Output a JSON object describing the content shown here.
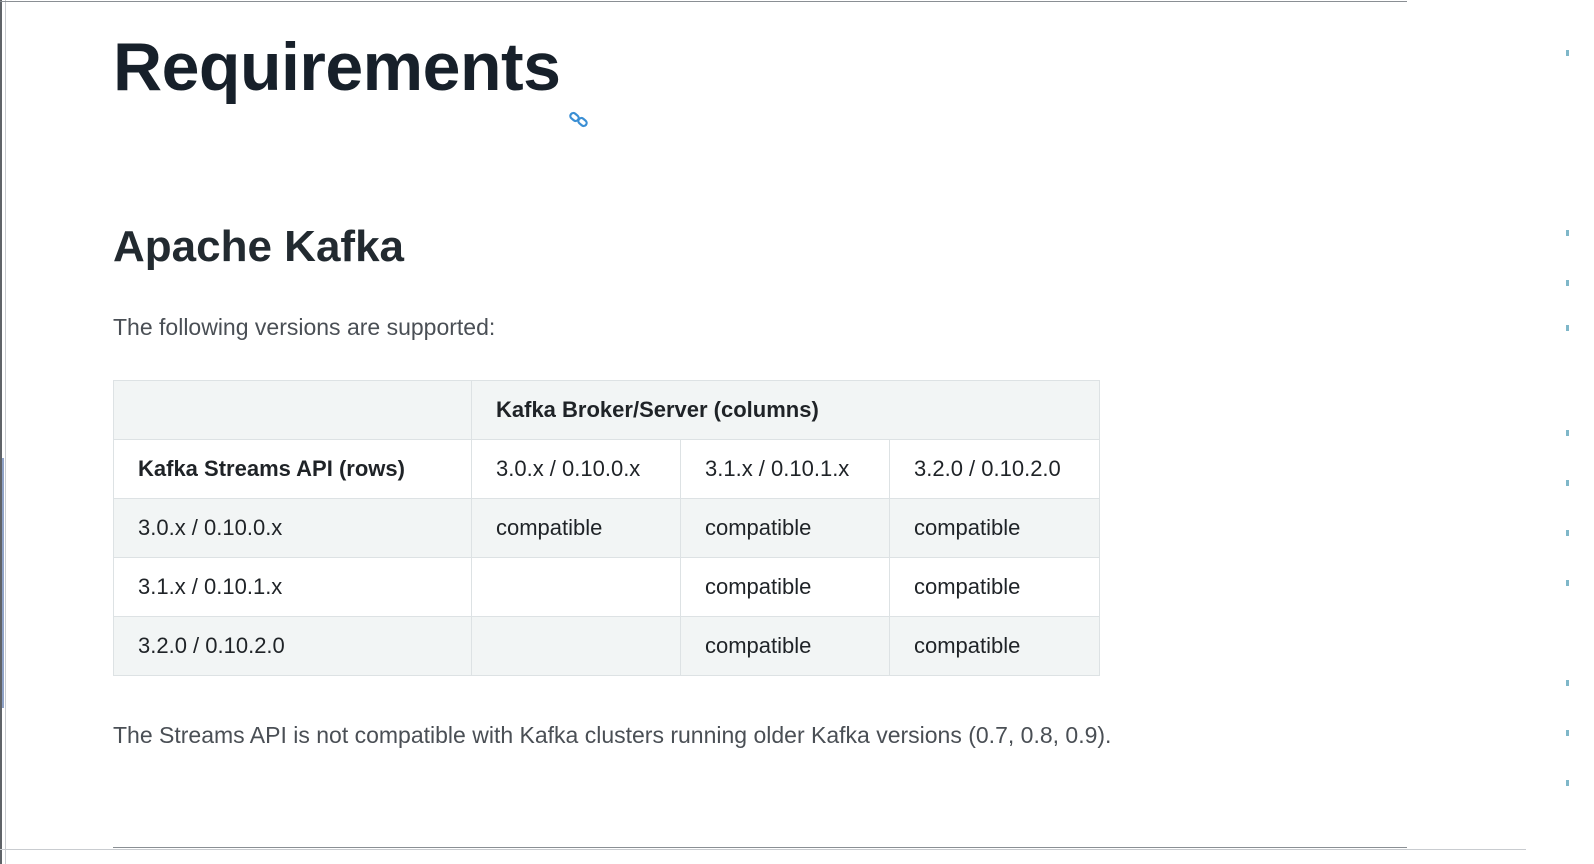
{
  "page": {
    "title": "Requirements",
    "title_anchor_icon": "link-icon",
    "section_title": "Apache Kafka",
    "intro": "The following versions are supported:",
    "footer_note": "The Streams API is not compatible with Kafka clusters running older Kafka versions (0.7, 0.8, 0.9)."
  },
  "colors": {
    "heading": "#17202a",
    "body_text": "#4a4f55",
    "table_shade": "#f2f5f5",
    "table_border": "#dde2e4",
    "link_icon": "#3b8fd4"
  },
  "table": {
    "header_top": {
      "corner": "",
      "columns_label": "Kafka Broker/Server (columns)"
    },
    "header_second": {
      "rows_label": "Kafka Streams API (rows)",
      "columns": [
        "3.0.x / 0.10.0.x",
        "3.1.x / 0.10.1.x",
        "3.2.0 / 0.10.2.0"
      ]
    },
    "rows": [
      {
        "version": "3.0.x / 0.10.0.x",
        "cells": [
          "compatible",
          "compatible",
          "compatible"
        ]
      },
      {
        "version": "3.1.x / 0.10.1.x",
        "cells": [
          "",
          "compatible",
          "compatible"
        ]
      },
      {
        "version": "3.2.0 / 0.10.2.0",
        "cells": [
          "",
          "compatible",
          "compatible"
        ]
      }
    ]
  }
}
